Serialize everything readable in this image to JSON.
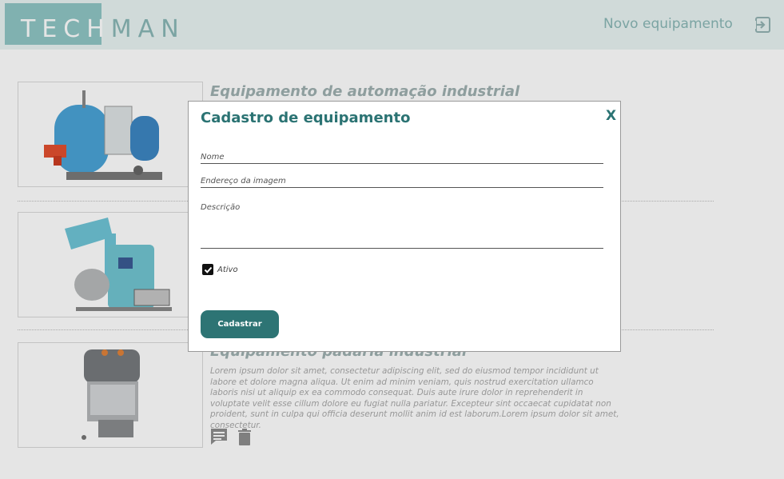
{
  "header": {
    "logo_highlight": "TECH",
    "logo_rest": "MAN",
    "new_equipment_label": "Novo equipamento",
    "logout_icon": "logout-icon"
  },
  "cards": [
    {
      "title": "Equipamento de automação industrial",
      "image": "industrial-boiler"
    },
    {
      "title": "",
      "image": "industrial-mixer"
    },
    {
      "title": "Equipamento padaria industrial",
      "image": "spiral-dough-mixer",
      "description": "Lorem ipsum dolor sit amet, consectetur adipiscing elit, sed do eiusmod tempor incididunt ut labore et dolore magna aliqua. Ut enim ad minim veniam, quis nostrud exercitation ullamco laboris nisi ut aliquip ex ea commodo consequat. Duis aute irure dolor in reprehenderit in voluptate velit esse cillum dolore eu fugiat nulla pariatur. Excepteur sint occaecat cupidatat non proident, sunt in culpa qui officia deserunt mollit anim id est laborum.Lorem ipsum dolor sit amet, consectetur.",
      "actions": [
        "comment-icon",
        "trash-icon"
      ]
    }
  ],
  "modal": {
    "title": "Cadastro de equipamento",
    "close_label": "X",
    "fields": {
      "name_placeholder": "Nome",
      "image_placeholder": "Endereço da imagem",
      "description_placeholder": "Descrição"
    },
    "active_label": "Ativo",
    "active_checked": true,
    "submit_label": "Cadastrar"
  },
  "colors": {
    "accent": "#2d7474",
    "header_bg": "#e8f3f2",
    "logo_box": "#8fc6c4"
  }
}
